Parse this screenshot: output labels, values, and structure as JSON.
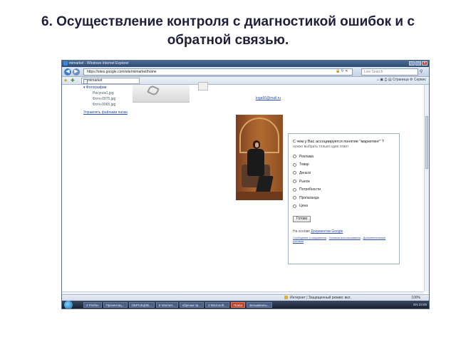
{
  "slide": {
    "title": "6. Осуществление контроля с диагностикой ошибок и с обратной связью."
  },
  "window": {
    "title": "mimarket - Windows Internet Explorer"
  },
  "address_bar": {
    "url": "https://sites.google.com/site/mimarket/home",
    "search_placeholder": "Live Search"
  },
  "tab": {
    "label": "mimarket"
  },
  "toolbar": {
    "page_menu": "Страница",
    "tools_menu": "Сервис"
  },
  "sidebar_tree": {
    "folder": "Фотографии",
    "files": [
      "Рисунок1.jpg",
      "Фото-0075.jpg",
      "Фото-0065.jpg"
    ],
    "manage_link": "Управлять файлами папки"
  },
  "email": "inga66@mail.ru",
  "form": {
    "question": "С чем у Вас ассоциируется понятие \"маркетинг\" ?",
    "hint": "нужно выбрать только один ответ",
    "options": [
      "Реклама",
      "Товар",
      "Деньги",
      "Рынок",
      "Потребности",
      "Пропаганда",
      "Цена"
    ],
    "submit_label": "Готово",
    "powered_prefix": "На основе",
    "powered_link": "Документов Google",
    "links": {
      "report": "Сообщение о нарушении",
      "terms": "Условия использования",
      "more": "Дополнительные условия"
    }
  },
  "status_bar": {
    "zone_text": "Интернет | Защищенный режим: вкл.",
    "zoom": "100%"
  },
  "taskbar": {
    "items": [
      "2 Firefox",
      "Презентац...",
      "ОБРАЗЦОВ...",
      "6 Internet...",
      "обрезки пр...",
      "2 Microsoft...",
      "Поиск",
      "Безымянны..."
    ],
    "active_index": 6,
    "lang": "EN",
    "clock": "23:00"
  }
}
